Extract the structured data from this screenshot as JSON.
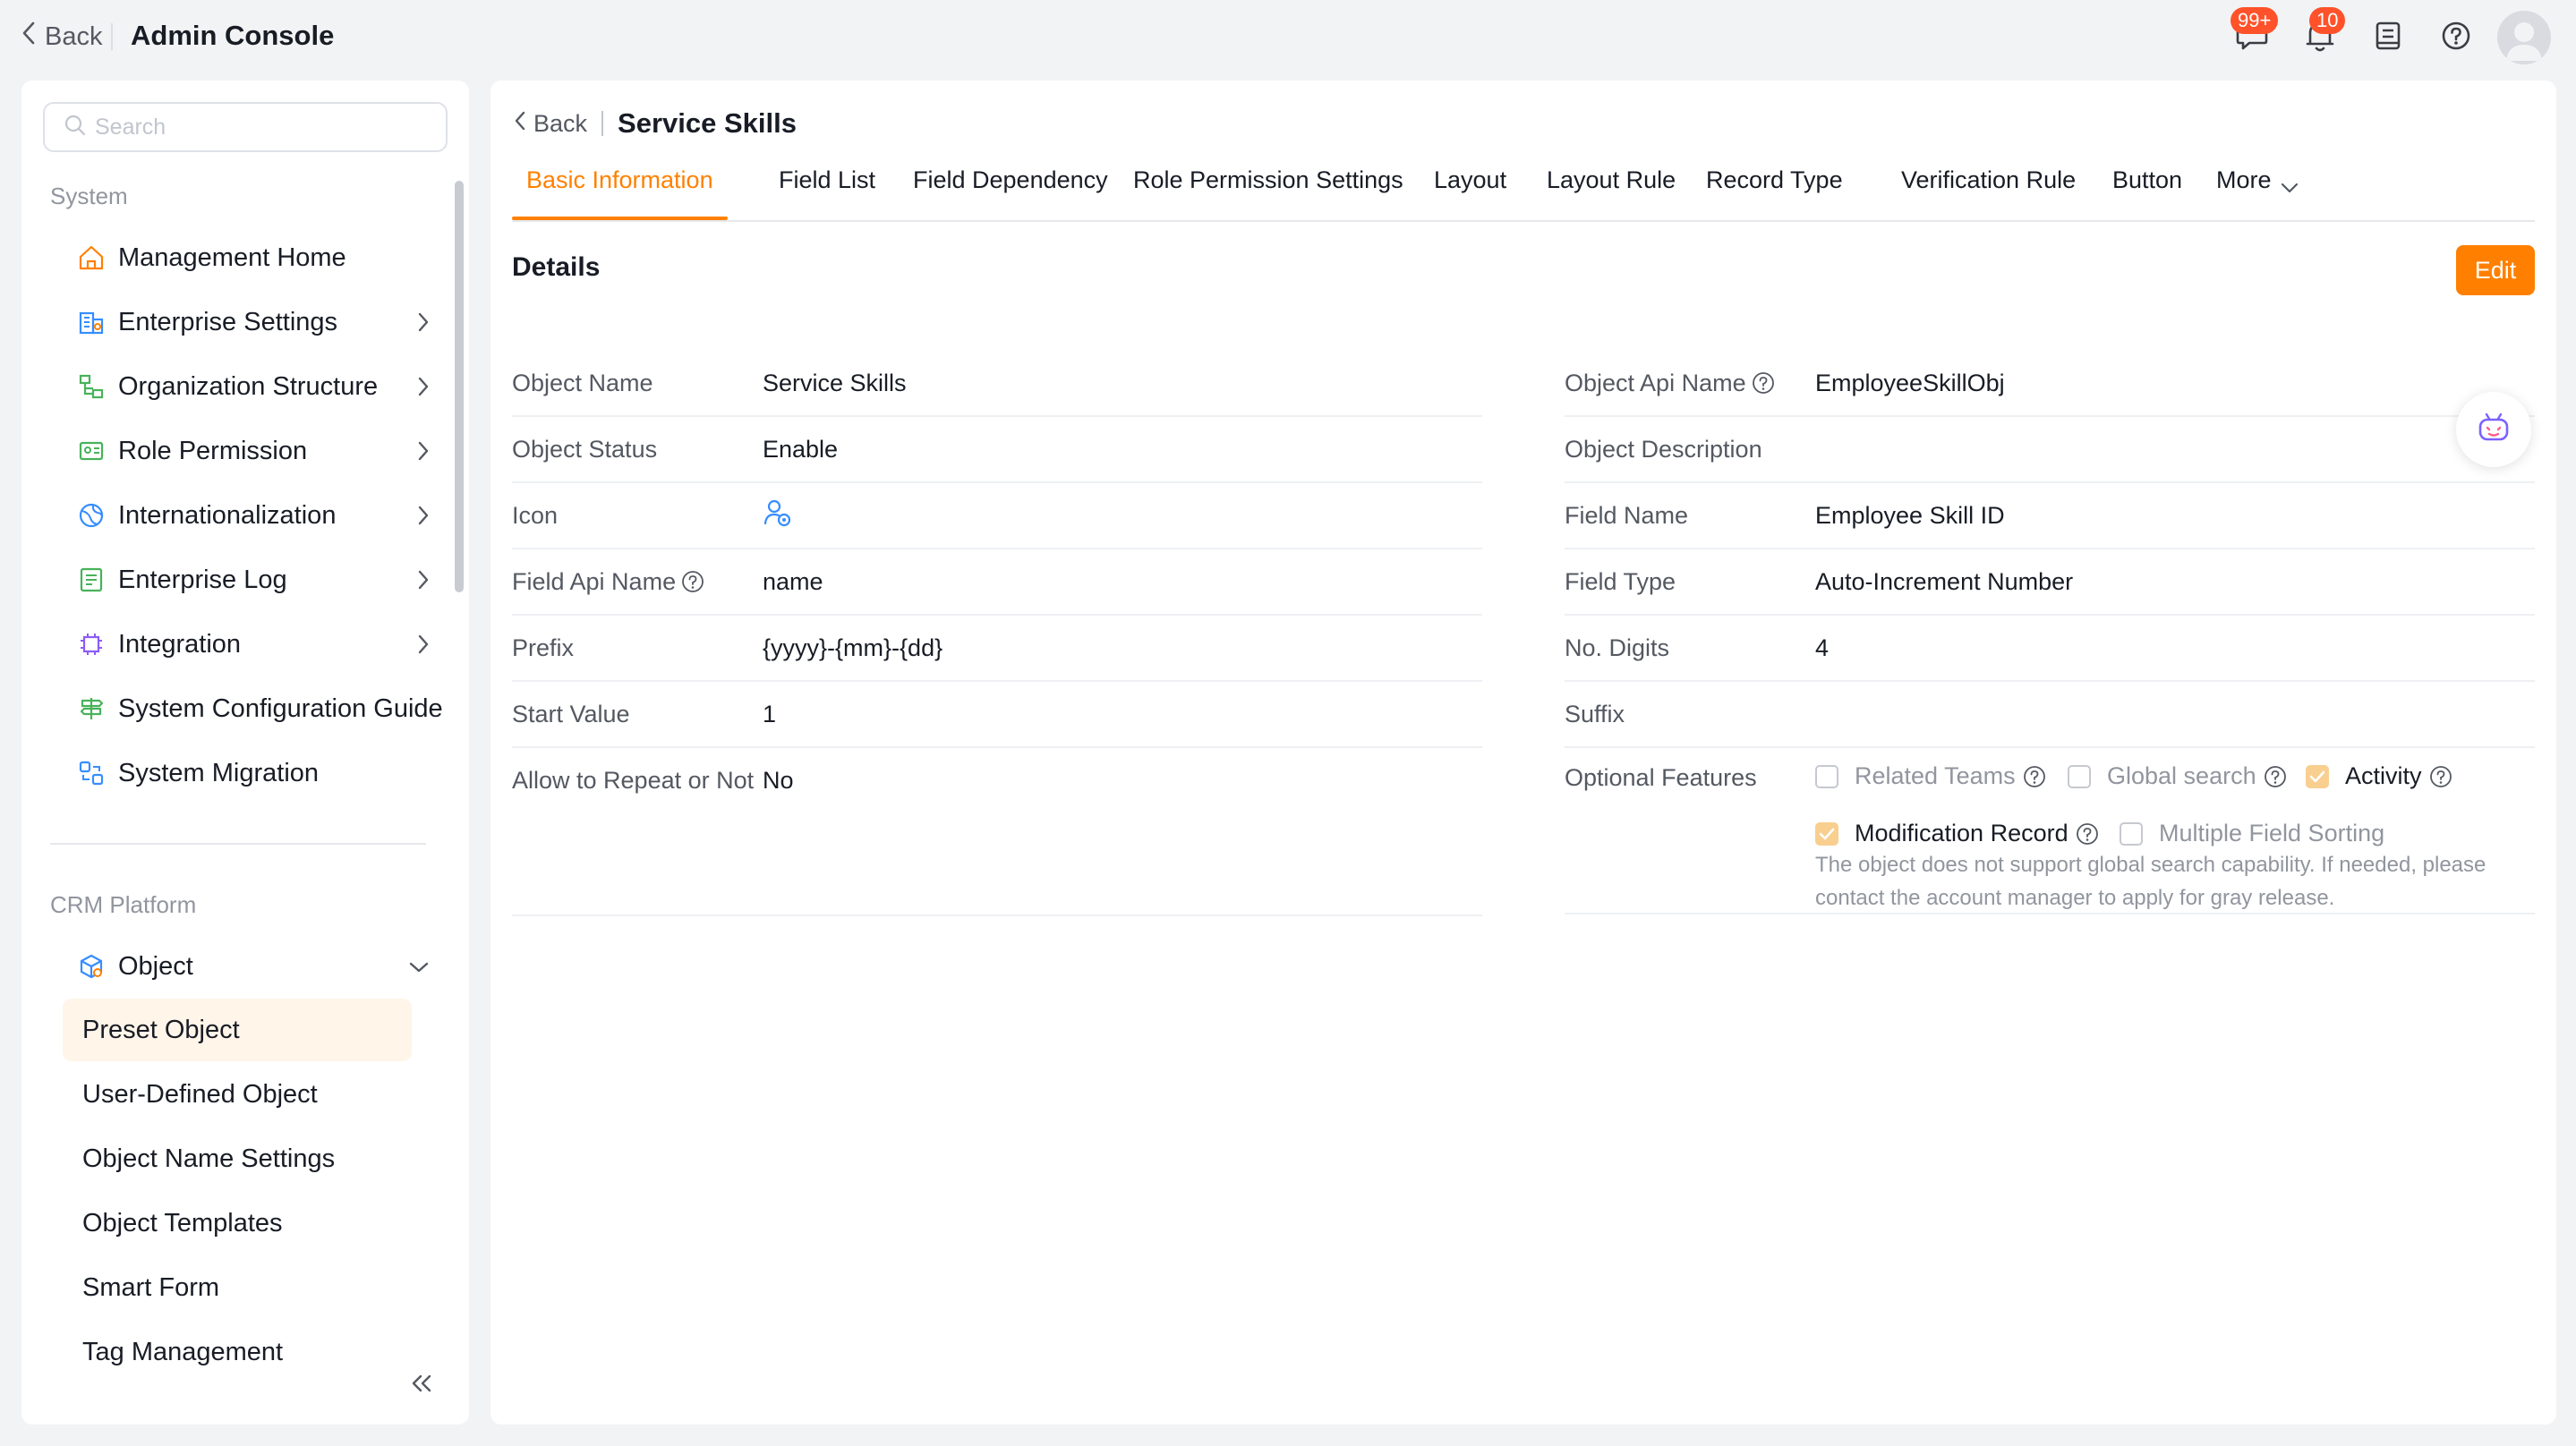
{
  "header": {
    "back_label": "Back",
    "title": "Admin Console",
    "messages_badge": "99+",
    "notifications_badge": "10"
  },
  "sidebar": {
    "search_placeholder": "Search",
    "group_system": "System",
    "system_items": [
      {
        "label": "Management Home",
        "icon": "home-icon"
      },
      {
        "label": "Enterprise Settings",
        "icon": "enterprise-icon"
      },
      {
        "label": "Organization Structure",
        "icon": "org-structure-icon"
      },
      {
        "label": "Role Permission",
        "icon": "role-card-icon"
      },
      {
        "label": "Internationalization",
        "icon": "globe-icon"
      },
      {
        "label": "Enterprise Log",
        "icon": "log-icon"
      },
      {
        "label": "Integration",
        "icon": "chip-icon"
      },
      {
        "label": "System Configuration Guide",
        "icon": "signpost-icon"
      },
      {
        "label": "System Migration",
        "icon": "migration-icon"
      }
    ],
    "group_crm": "CRM Platform",
    "object_label": "Object",
    "object_children": [
      "Preset Object",
      "User-Defined Object",
      "Object Name Settings",
      "Object Templates",
      "Smart Form",
      "Tag Management"
    ]
  },
  "main": {
    "back_label": "Back",
    "title": "Service Skills",
    "tabs": [
      "Basic Information",
      "Field List",
      "Field Dependency",
      "Role Permission Settings",
      "Layout",
      "Layout Rule",
      "Record Type",
      "Verification Rule",
      "Button",
      "More"
    ],
    "section_title": "Details",
    "edit_label": "Edit",
    "left_fields": [
      {
        "key": "Object Name",
        "value": "Service Skills"
      },
      {
        "key": "Object Status",
        "value": "Enable"
      },
      {
        "key": "Icon",
        "value": ""
      },
      {
        "key": "Field Api Name",
        "value": "name"
      },
      {
        "key": "Prefix",
        "value": "{yyyy}-{mm}-{dd}"
      },
      {
        "key": "Start Value",
        "value": "1"
      },
      {
        "key": "Allow to Repeat or Not",
        "value": "No"
      }
    ],
    "right_fields": [
      {
        "key": "Object Api Name",
        "value": "EmployeeSkillObj"
      },
      {
        "key": "Object Description",
        "value": ""
      },
      {
        "key": "Field Name",
        "value": "Employee Skill ID"
      },
      {
        "key": "Field Type",
        "value": "Auto-Increment Number"
      },
      {
        "key": "No. Digits",
        "value": "4"
      },
      {
        "key": "Suffix",
        "value": ""
      }
    ],
    "optional_features": {
      "label": "Optional Features",
      "options": [
        {
          "label": "Related Teams",
          "checked": false,
          "disabled": true
        },
        {
          "label": "Global search",
          "checked": false,
          "disabled": true
        },
        {
          "label": "Activity",
          "checked": true,
          "disabled": false
        },
        {
          "label": "Modification Record",
          "checked": true,
          "disabled": false
        },
        {
          "label": "Multiple Field Sorting",
          "checked": false,
          "disabled": true
        }
      ],
      "note": "The object does not support global search capability. If needed, please contact the account manager to apply for gray release."
    }
  },
  "colors": {
    "accent": "#ff8000",
    "badge": "#ff522a",
    "active_bg": "#fff5e9",
    "checked": "#f8cf8f",
    "icon_blue": "#368dff"
  }
}
